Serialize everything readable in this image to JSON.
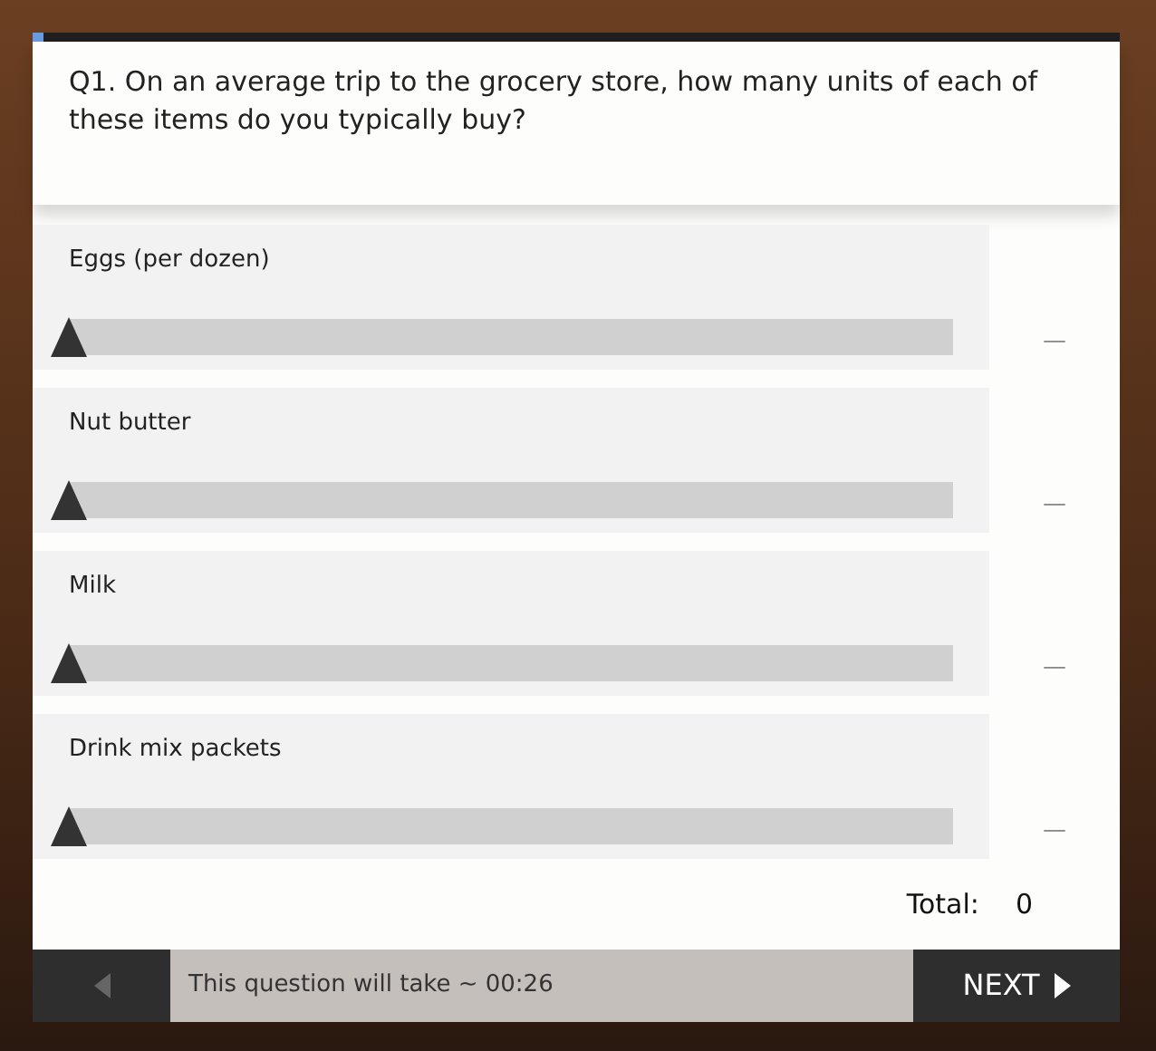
{
  "progress": {
    "level": 0.01
  },
  "question": "Q1. On an average trip to the grocery store, how many units of each of these items do you typically buy?",
  "items": [
    {
      "label": "Eggs (per dozen)",
      "level": 0,
      "reading": "—"
    },
    {
      "label": "Nut butter",
      "level": 0,
      "reading": "—"
    },
    {
      "label": "Milk",
      "level": 0,
      "reading": "—"
    },
    {
      "label": "Drink mix packets",
      "level": 0,
      "reading": "—"
    }
  ],
  "total": {
    "label": "Total:",
    "value": "0"
  },
  "footer": {
    "back_disabled": true,
    "timer": "This question will take ~ 00:26",
    "next": "NEXT"
  }
}
